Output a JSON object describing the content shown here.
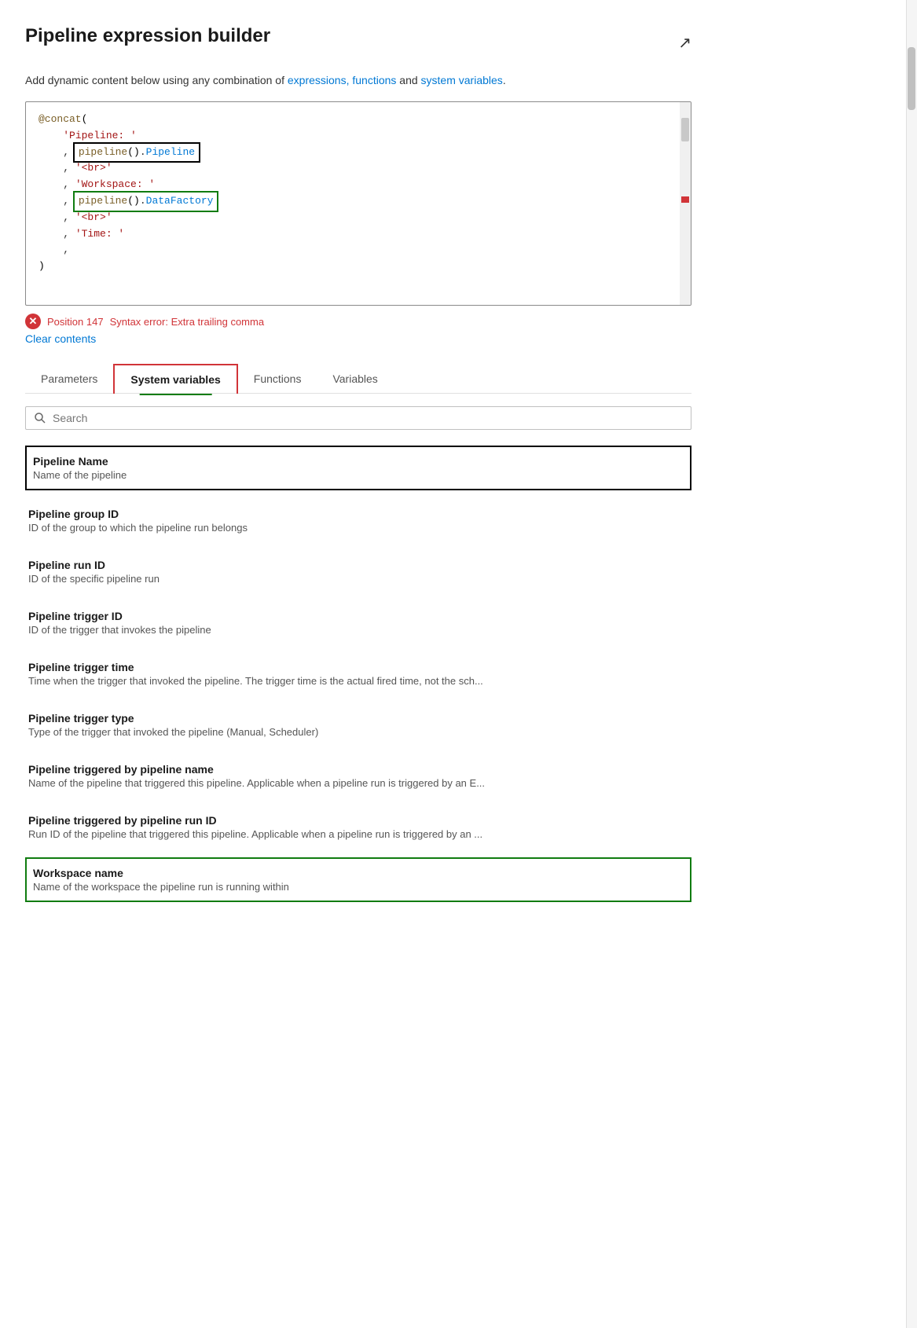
{
  "title": "Pipeline expression builder",
  "subtitle": {
    "text_before": "Add dynamic content below using any combination of ",
    "link1": "expressions, functions",
    "text_middle": " and ",
    "link2": "system variables",
    "text_after": "."
  },
  "code": {
    "lines": [
      "@concat(",
      "    'Pipeline: '",
      "    , pipeline().Pipeline",
      "    , '<br>'",
      "    , 'Workspace: '",
      "    , pipeline().DataFactory",
      "    , '<br>'",
      "    , 'Time: '",
      "    ,",
      ")"
    ]
  },
  "error": {
    "position": "Position 147",
    "message": "Syntax error: Extra trailing comma"
  },
  "clear_contents": "Clear contents",
  "tabs": [
    {
      "id": "parameters",
      "label": "Parameters",
      "active": false
    },
    {
      "id": "system-variables",
      "label": "System variables",
      "active": true
    },
    {
      "id": "functions",
      "label": "Functions",
      "active": false
    },
    {
      "id": "variables",
      "label": "Variables",
      "active": false
    }
  ],
  "search": {
    "placeholder": "Search"
  },
  "system_variables": [
    {
      "id": "pipeline-name",
      "name": "Pipeline Name",
      "desc": "Name of the pipeline",
      "highlight": "black"
    },
    {
      "id": "pipeline-group-id",
      "name": "Pipeline group ID",
      "desc": "ID of the group to which the pipeline run belongs",
      "highlight": ""
    },
    {
      "id": "pipeline-run-id",
      "name": "Pipeline run ID",
      "desc": "ID of the specific pipeline run",
      "highlight": ""
    },
    {
      "id": "pipeline-trigger-id",
      "name": "Pipeline trigger ID",
      "desc": "ID of the trigger that invokes the pipeline",
      "highlight": ""
    },
    {
      "id": "pipeline-trigger-time",
      "name": "Pipeline trigger time",
      "desc": "Time when the trigger that invoked the pipeline. The trigger time is the actual fired time, not the sch...",
      "highlight": ""
    },
    {
      "id": "pipeline-trigger-type",
      "name": "Pipeline trigger type",
      "desc": "Type of the trigger that invoked the pipeline (Manual, Scheduler)",
      "highlight": ""
    },
    {
      "id": "pipeline-triggered-by-name",
      "name": "Pipeline triggered by pipeline name",
      "desc": "Name of the pipeline that triggered this pipeline. Applicable when a pipeline run is triggered by an E...",
      "highlight": ""
    },
    {
      "id": "pipeline-triggered-by-run-id",
      "name": "Pipeline triggered by pipeline run ID",
      "desc": "Run ID of the pipeline that triggered this pipeline. Applicable when a pipeline run is triggered by an ...",
      "highlight": ""
    },
    {
      "id": "workspace-name",
      "name": "Workspace name",
      "desc": "Name of the workspace the pipeline run is running within",
      "highlight": "green"
    }
  ],
  "icons": {
    "expand": "↗",
    "error_x": "✕",
    "search": "search"
  }
}
